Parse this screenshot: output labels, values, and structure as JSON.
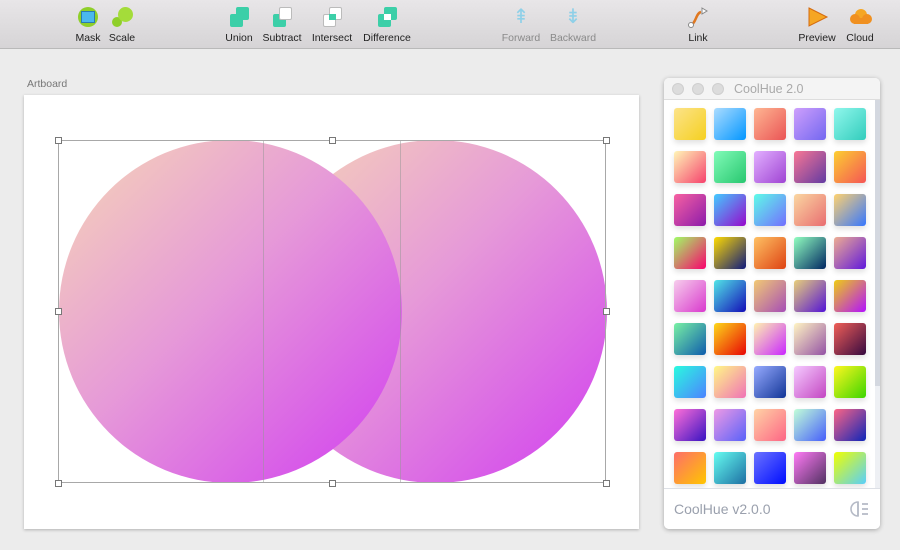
{
  "toolbar": {
    "items": [
      {
        "label": "Mask"
      },
      {
        "label": "Scale"
      },
      {
        "label": "Union"
      },
      {
        "label": "Subtract"
      },
      {
        "label": "Intersect"
      },
      {
        "label": "Difference"
      },
      {
        "label": "Forward"
      },
      {
        "label": "Backward"
      },
      {
        "label": "Link"
      },
      {
        "label": "Preview"
      },
      {
        "label": "Cloud"
      }
    ]
  },
  "canvas": {
    "artboard_label": "Artboard"
  },
  "panel": {
    "title": "CoolHue 2.0",
    "footer": "CoolHue v2.0.0",
    "gradients": [
      [
        "#FCE38A",
        "#F5D020"
      ],
      [
        "#ABDCFF",
        "#0396FF"
      ],
      [
        "#FEB692",
        "#EA5455"
      ],
      [
        "#CE9FFC",
        "#7367F0"
      ],
      [
        "#90F7EC",
        "#32CCBC"
      ],
      [
        "#FFF6B7",
        "#F6416C"
      ],
      [
        "#81FBB8",
        "#28C76F"
      ],
      [
        "#E2B0FF",
        "#9F44D3"
      ],
      [
        "#F97794",
        "#623AA2"
      ],
      [
        "#FCCF31",
        "#F55555"
      ],
      [
        "#F761A1",
        "#8C1BAB"
      ],
      [
        "#43CBFF",
        "#9708CC"
      ],
      [
        "#5EFCE8",
        "#736EFE"
      ],
      [
        "#FAD7A1",
        "#E96D71"
      ],
      [
        "#FFD26F",
        "#3677FF"
      ],
      [
        "#A0FE65",
        "#FA016D"
      ],
      [
        "#FFDB01",
        "#0E197D"
      ],
      [
        "#FEC163",
        "#DE4313"
      ],
      [
        "#92FFC0",
        "#002661"
      ],
      [
        "#EEAD92",
        "#6018DC"
      ],
      [
        "#F6CEEC",
        "#D939CD"
      ],
      [
        "#52E5E7",
        "#130CB7"
      ],
      [
        "#F1CA74",
        "#A64DB6"
      ],
      [
        "#E8D07A",
        "#5312D6"
      ],
      [
        "#EECE13",
        "#B210FF"
      ],
      [
        "#79F1A4",
        "#0E5CAD"
      ],
      [
        "#FDD819",
        "#E80505"
      ],
      [
        "#FFF3B0",
        "#CA26FF"
      ],
      [
        "#FFF5C3",
        "#9452A5"
      ],
      [
        "#F05F57",
        "#360940"
      ],
      [
        "#2AFADF",
        "#4C83FF"
      ],
      [
        "#FFF886",
        "#F072B6"
      ],
      [
        "#97ABFF",
        "#123597"
      ],
      [
        "#F5CBFF",
        "#C346C2"
      ],
      [
        "#FFF720",
        "#3CD500"
      ],
      [
        "#FF6FD8",
        "#3813C2"
      ],
      [
        "#EE9AE5",
        "#5961F9"
      ],
      [
        "#FFD3A5",
        "#FD6585"
      ],
      [
        "#C2FFD8",
        "#465EFB"
      ],
      [
        "#FD6585",
        "#0D25B9"
      ],
      [
        "#FD6E6A",
        "#FFC600"
      ],
      [
        "#65FDF0",
        "#1D6FA3"
      ],
      [
        "#6B73FF",
        "#000DFF"
      ],
      [
        "#FF7AF5",
        "#513162"
      ],
      [
        "#F0FF00",
        "#58CFFB"
      ]
    ]
  }
}
